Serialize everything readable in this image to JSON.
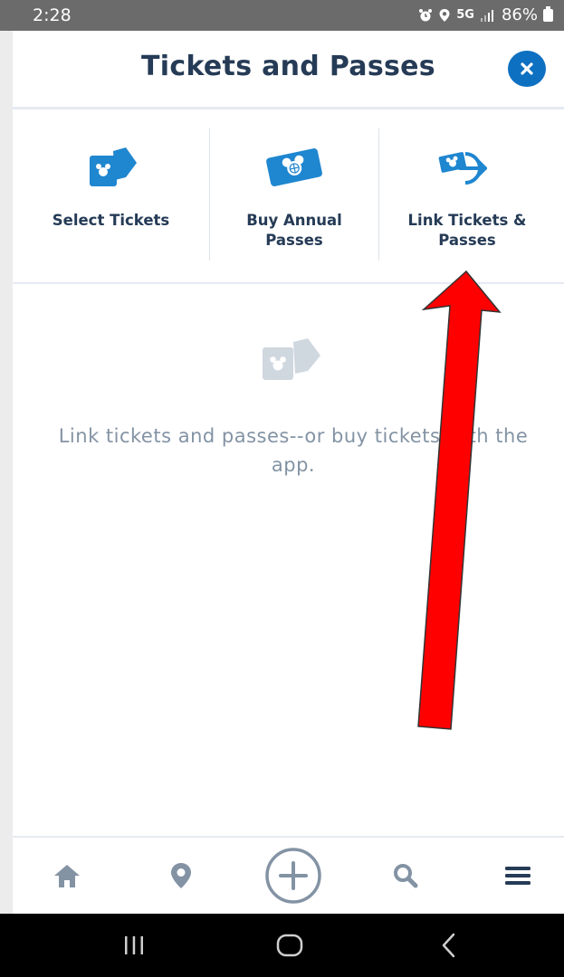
{
  "status_bar": {
    "time": "2:28",
    "network": "5G",
    "battery": "86%",
    "icons": [
      "alarm-icon",
      "location-icon",
      "signal-icon",
      "battery-icon"
    ]
  },
  "header": {
    "title": "Tickets and Passes",
    "close_icon": "close-icon"
  },
  "options": [
    {
      "line1": "Select Tickets",
      "line2": "",
      "icon": "tickets-icon"
    },
    {
      "line1": "Buy Annual",
      "line2": "Passes",
      "icon": "annual-pass-icon"
    },
    {
      "line1": "Link Tickets &",
      "line2": "Passes",
      "icon": "link-tickets-icon"
    }
  ],
  "empty_state": {
    "line1": "Link tickets and passes--or buy tickets with the",
    "line2": "app.",
    "icon": "tickets-icon"
  },
  "bottom_nav": {
    "items": [
      "home-icon",
      "map-pin-icon",
      "add-icon",
      "search-icon",
      "menu-icon"
    ]
  },
  "system_nav": {
    "items": [
      "recent-apps-icon",
      "home-button-icon",
      "back-icon"
    ]
  },
  "colors": {
    "primary_blue": "#1f86d0",
    "dark_blue": "#0d70c1",
    "title_text": "#253b56",
    "muted_text": "#8393a4",
    "annotation_red": "#ff0000"
  }
}
